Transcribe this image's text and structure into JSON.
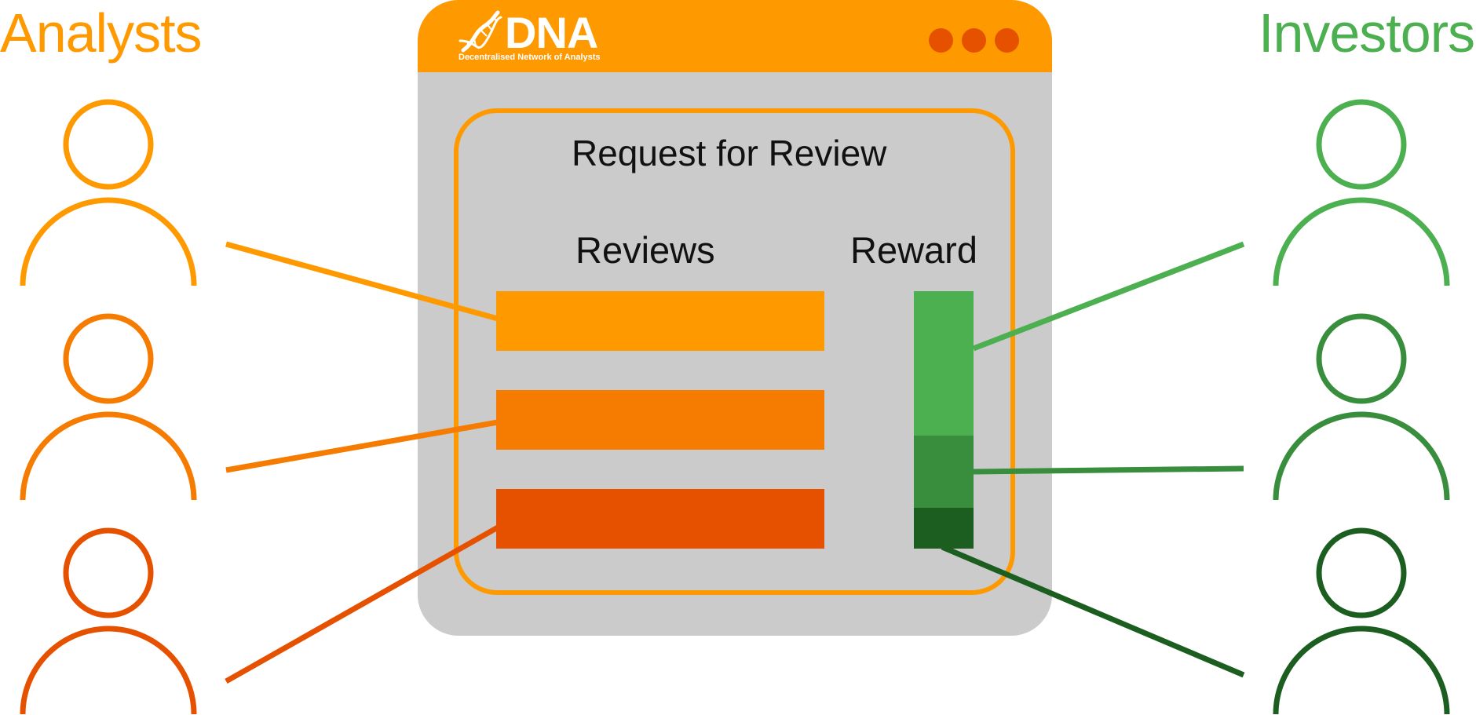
{
  "headings": {
    "analysts": "Analysts",
    "investors": "Investors"
  },
  "window": {
    "brand_name": "DNA",
    "brand_subtitle": "Decentralised Network of Analysts",
    "brand_icon": "dna-helix-icon",
    "panel_title": "Request for Review",
    "reviews_label": "Reviews",
    "reward_label": "Reward"
  },
  "colors": {
    "window_bg": "#cbcbcb",
    "titlebar": "#ff9900",
    "title_dots": "#e65100",
    "panel_border": "#ff9900",
    "analyst_1": "#ff9900",
    "analyst_2": "#f57c00",
    "analyst_3": "#e65100",
    "investor_1": "#4caf50",
    "investor_2": "#388e3c",
    "investor_3": "#1b5e20"
  },
  "reviews": [
    {
      "color": "#ff9900"
    },
    {
      "color": "#f57c00"
    },
    {
      "color": "#e65100"
    }
  ],
  "reward_segments": [
    {
      "color": "#4caf50",
      "share": 0.56
    },
    {
      "color": "#388e3c",
      "share": 0.28
    },
    {
      "color": "#1b5e20",
      "share": 0.16
    }
  ]
}
